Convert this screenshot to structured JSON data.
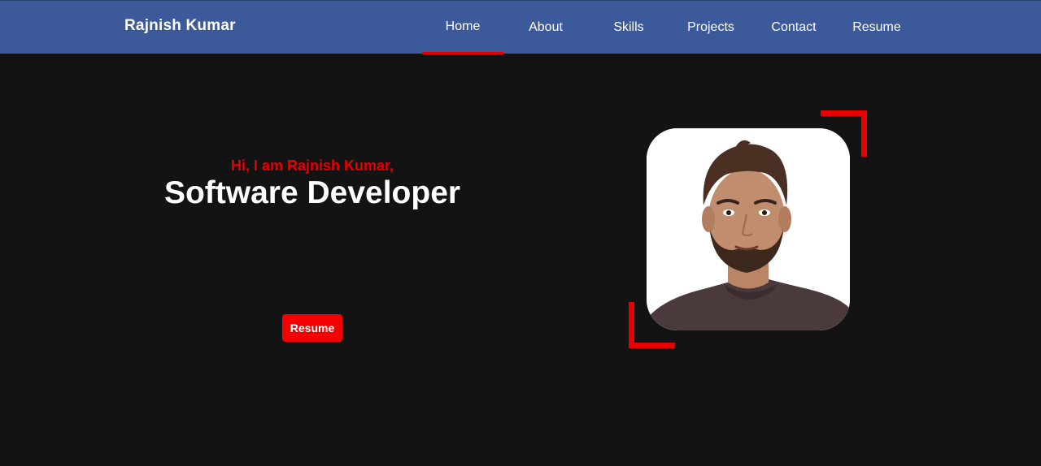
{
  "navbar": {
    "brand": "Rajnish Kumar",
    "items": [
      {
        "label": "Home",
        "active": true
      },
      {
        "label": "About",
        "active": false
      },
      {
        "label": "Skills",
        "active": false
      },
      {
        "label": "Projects",
        "active": false
      },
      {
        "label": "Contact",
        "active": false
      },
      {
        "label": "Resume",
        "active": false
      }
    ]
  },
  "hero": {
    "greeting": "Hi, I am Rajnish Kumar,",
    "title": "Software Developer",
    "button_label": "Resume"
  },
  "profile": {
    "photo_alt": "profile photo"
  },
  "colors": {
    "navbar_bg": "#3c5a9a",
    "page_bg": "#131313",
    "accent": "#e60000",
    "text": "#ffffff"
  }
}
